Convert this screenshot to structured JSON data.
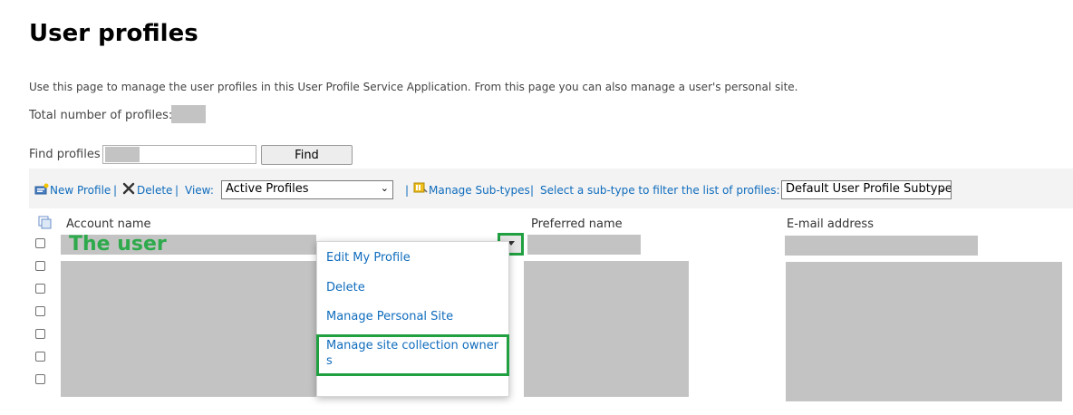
{
  "page": {
    "title": "User profiles",
    "description": "Use this page to manage the user profiles in this User Profile Service Application. From this page you can also manage a user's personal site.",
    "total_label": "Total number of profiles:",
    "find_label": "Find profiles",
    "find_button": "Find"
  },
  "toolbar": {
    "new_profile": "New Profile",
    "delete": "Delete",
    "view_label": "View:",
    "view_selected": "Active Profiles",
    "manage_subtypes": "Manage Sub-types",
    "subtype_hint": "Select a sub-type to filter the list of profiles:",
    "subtype_selected": "Default User Profile Subtype",
    "separator": "|"
  },
  "table": {
    "columns": [
      "Account name",
      "Preferred name",
      "E-mail address"
    ],
    "row_count": 7
  },
  "annotation": {
    "label": "The user",
    "color": "#2eaa4c"
  },
  "context_menu": {
    "items": [
      "Edit My Profile",
      "Delete",
      "Manage Personal Site",
      "Manage site collection owner",
      "s"
    ]
  },
  "icons": {
    "new_profile": "new-profile-icon",
    "delete": "delete-x-icon",
    "manage_subtypes": "manage-subtypes-icon",
    "select_all": "select-all-icon",
    "dropdown": "chevron-down-icon"
  },
  "colors": {
    "link": "#0f6cbd",
    "highlight": "#20a040",
    "redaction": "#c3c3c3",
    "toolbar_bg": "#f3f3f3"
  }
}
